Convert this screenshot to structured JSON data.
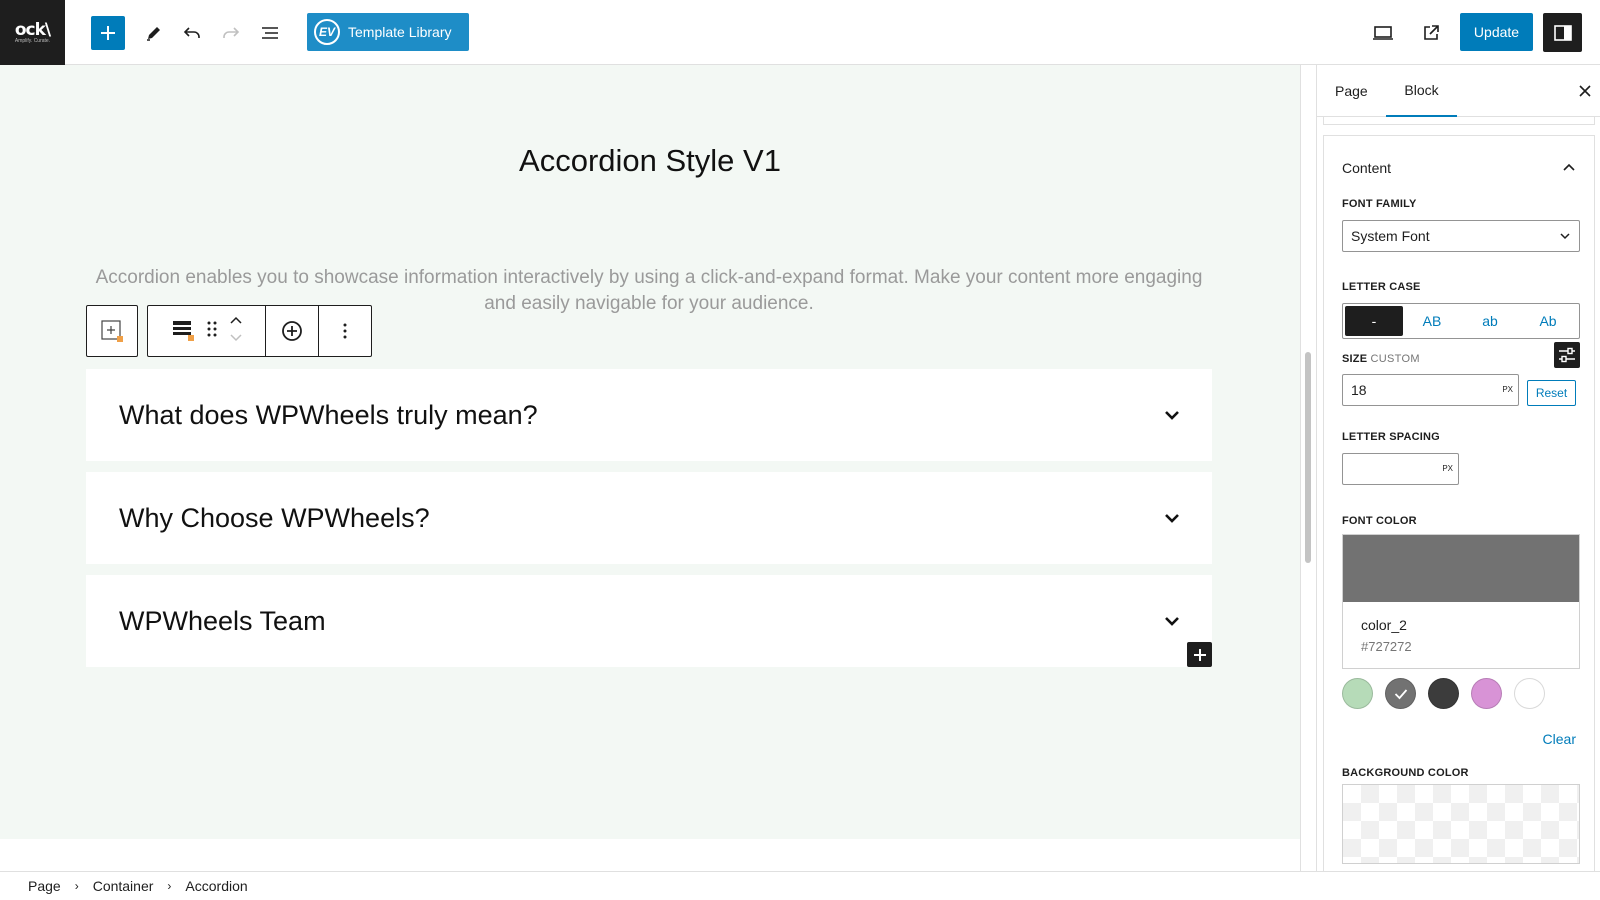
{
  "app": {
    "logo_text": "ock\\",
    "logo_subtext": "Amplify. Curate."
  },
  "toolbar": {
    "add_block": "Add block",
    "tools": "Tools",
    "undo": "Undo",
    "redo": "Redo",
    "document_overview": "Document overview",
    "template_library_label": "Template Library",
    "template_library_badge": "EV",
    "preview": "Preview",
    "view_page": "View Page",
    "update_label": "Update",
    "settings": "Settings"
  },
  "editor": {
    "title": "Accordion Style V1",
    "description": "Accordion enables you to showcase information interactively by using a click-and-expand format. Make your content more engaging and easily navigable for your audience.",
    "accordion_items": [
      {
        "title": "What does WPWheels truly mean?"
      },
      {
        "title": "Why Choose WPWheels?"
      },
      {
        "title": "WPWheels Team"
      }
    ]
  },
  "breadcrumb": [
    "Page",
    "Container",
    "Accordion"
  ],
  "sidebar": {
    "tabs": [
      "Page",
      "Block"
    ],
    "active_tab": "Block",
    "panel_title": "Content",
    "font_family_label": "FONT FAMILY",
    "font_family_value": "System Font",
    "letter_case_label": "LETTER CASE",
    "letter_case_options": [
      "-",
      "AB",
      "ab",
      "Ab"
    ],
    "letter_case_selected": "-",
    "size_label": "SIZE",
    "size_sublabel": "CUSTOM",
    "size_value": "18",
    "size_unit": "PX",
    "reset_label": "Reset",
    "letter_spacing_label": "LETTER SPACING",
    "letter_spacing_value": "",
    "letter_spacing_unit": "PX",
    "font_color_label": "FONT COLOR",
    "font_color_name": "color_2",
    "font_color_hex": "#727272",
    "palette": [
      "#b6dbb8",
      "#727272",
      "#3c3c3c",
      "#d893d6",
      "#ffffff"
    ],
    "palette_selected_index": 1,
    "clear_label": "Clear",
    "background_color_label": "BACKGROUND COLOR"
  },
  "colors": {
    "accent": "#007cba",
    "template_library_bg": "#1e8dc7",
    "canvas_bg": "#f3f8f4",
    "dark": "#1e1e1e"
  }
}
